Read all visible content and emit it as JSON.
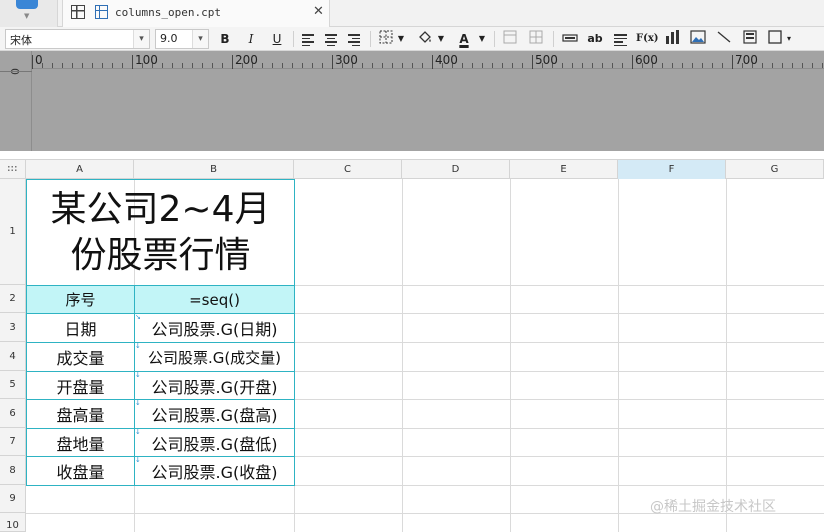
{
  "tab": {
    "file_name": "columns_open.cpt"
  },
  "toolbar": {
    "font_name": "宋体",
    "font_size": "9.0",
    "bold": "B",
    "italic": "I",
    "underline": "U",
    "text_color_label": "A",
    "text_color": "#000000",
    "ab_label": "ab",
    "formula_label": "F(x)"
  },
  "ruler": {
    "vertical_zero": "0",
    "marks": [
      "0",
      "100",
      "200",
      "300",
      "400",
      "500",
      "600",
      "700"
    ]
  },
  "sheet": {
    "columns": [
      "A",
      "B",
      "C",
      "D",
      "E",
      "F",
      "G"
    ],
    "selected_column": "F",
    "rows": [
      "1",
      "2",
      "3",
      "4",
      "5",
      "6",
      "7",
      "8",
      "9",
      "10"
    ],
    "title": "某公司2~4月份股票行情",
    "header": {
      "a": "序号",
      "b": "=seq()"
    },
    "data": [
      {
        "a": "日期",
        "b": "公司股票.G(日期)"
      },
      {
        "a": "成交量",
        "b": "公司股票.G(成交量)"
      },
      {
        "a": "开盘量",
        "b": "公司股票.G(开盘)"
      },
      {
        "a": "盘高量",
        "b": "公司股票.G(盘高)"
      },
      {
        "a": "盘地量",
        "b": "公司股票.G(盘低)"
      },
      {
        "a": "收盘量",
        "b": "公司股票.G(收盘)"
      }
    ],
    "header_fill": "#c2f5f7",
    "border_color": "#2eb3c3"
  },
  "watermark": "@稀土掘金技术社区"
}
